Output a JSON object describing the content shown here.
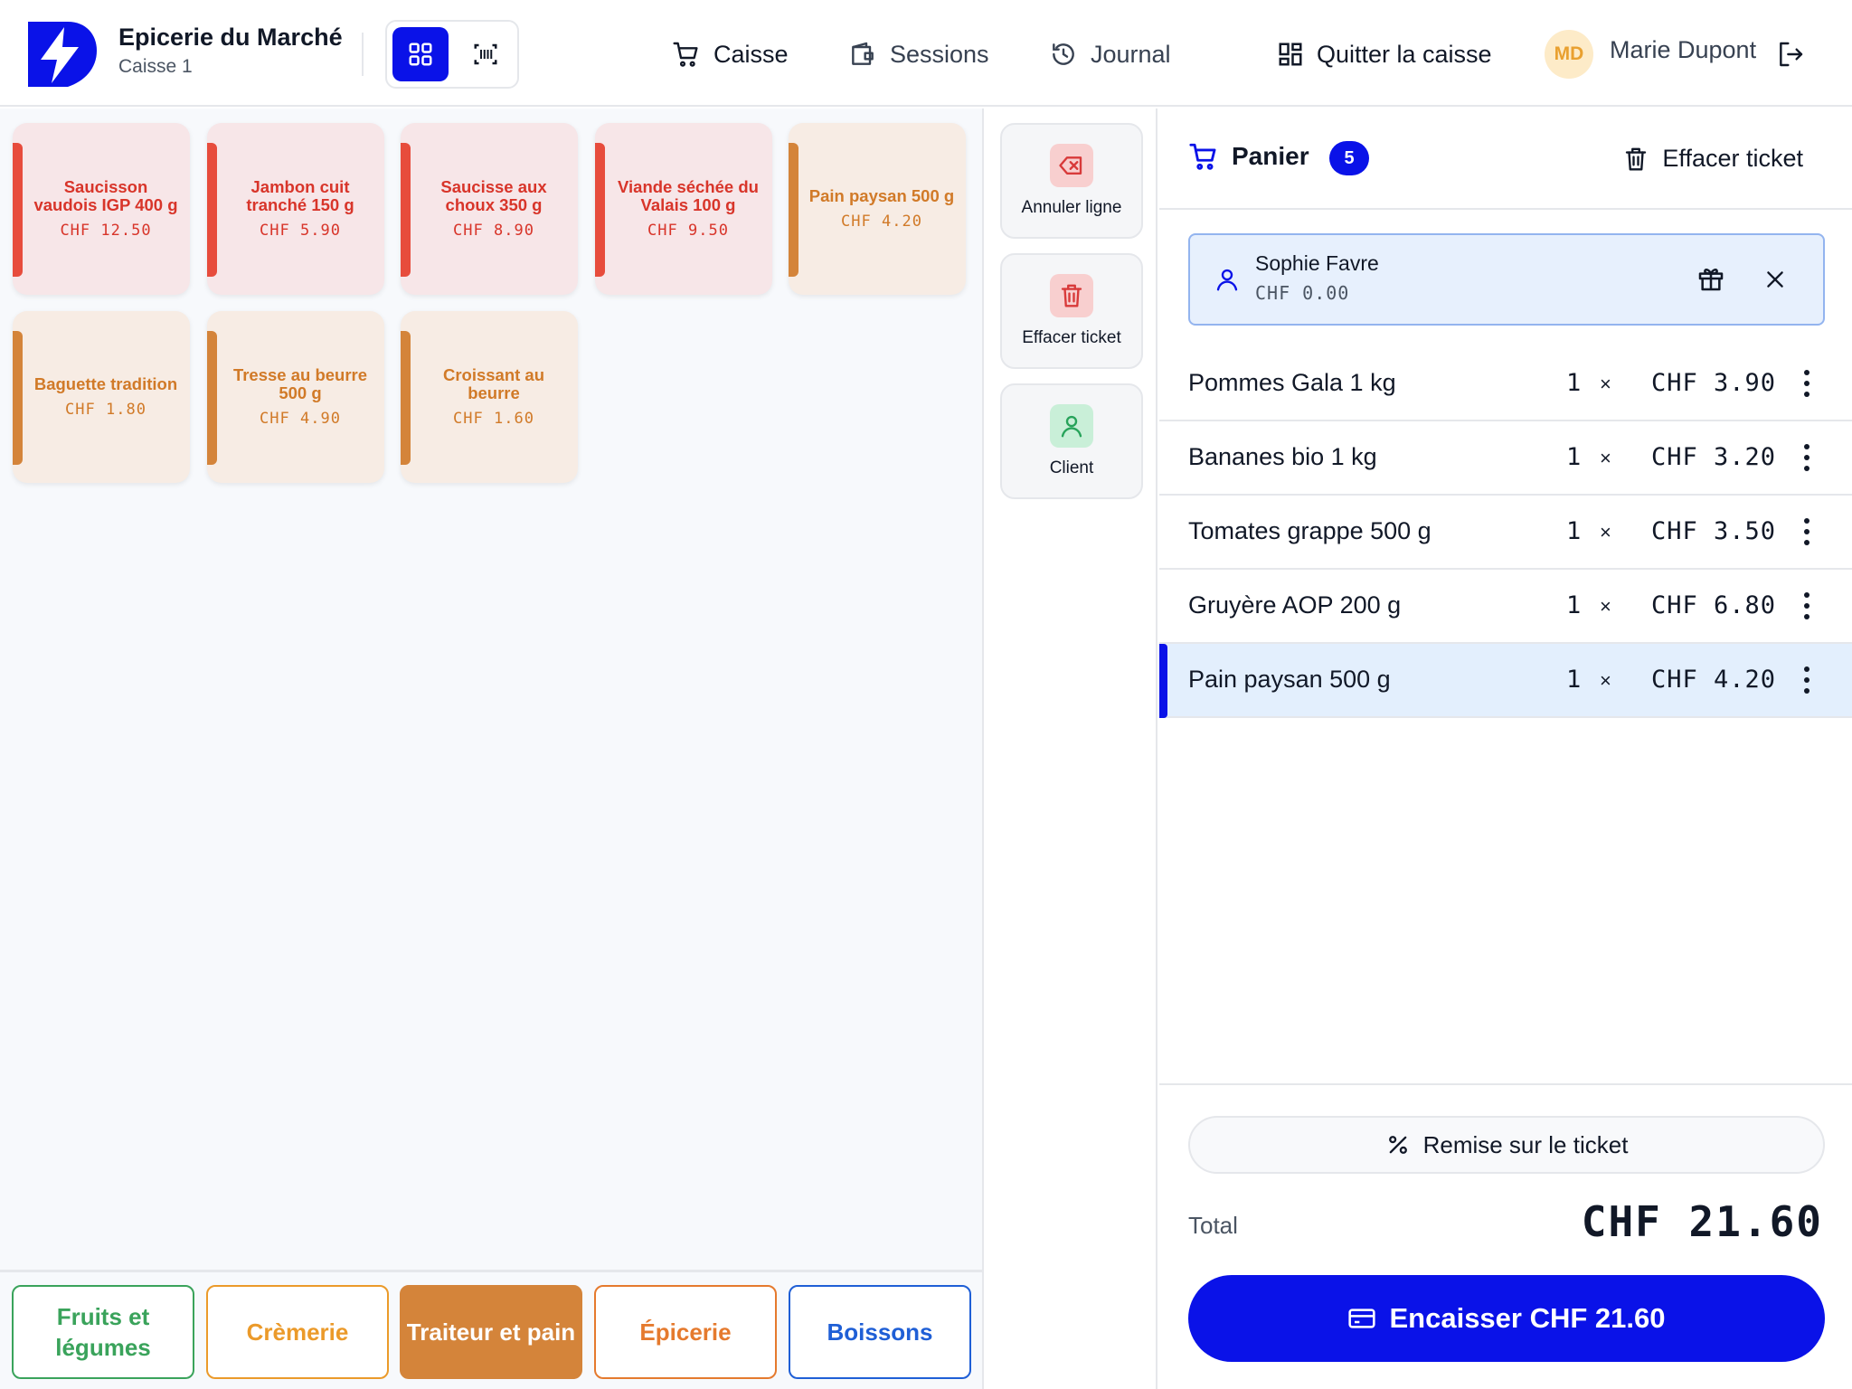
{
  "header": {
    "store_name": "Epicerie du Marché",
    "register": "Caisse 1",
    "nav": [
      {
        "label": "Caisse",
        "icon": "cart-icon",
        "active": true
      },
      {
        "label": "Sessions",
        "icon": "wallet-icon",
        "active": false
      },
      {
        "label": "Journal",
        "icon": "history-icon",
        "active": false
      },
      {
        "label": "Quitter la caisse",
        "icon": "dashboard-icon",
        "active": false
      }
    ],
    "user": {
      "initials": "MD",
      "name": "Marie Dupont"
    }
  },
  "products": [
    {
      "name": "Saucisson vaudois IGP 400 g",
      "price": "CHF 12.50",
      "category": "meat"
    },
    {
      "name": "Jambon cuit tranché 150 g",
      "price": "CHF 5.90",
      "category": "meat"
    },
    {
      "name": "Saucisse aux choux 350 g",
      "price": "CHF 8.90",
      "category": "meat"
    },
    {
      "name": "Viande séchée du Valais 100 g",
      "price": "CHF 9.50",
      "category": "meat"
    },
    {
      "name": "Pain paysan 500 g",
      "price": "CHF 4.20",
      "category": "bread"
    },
    {
      "name": "Baguette tradition",
      "price": "CHF 1.80",
      "category": "bread"
    },
    {
      "name": "Tresse au beurre 500 g",
      "price": "CHF 4.90",
      "category": "bread"
    },
    {
      "name": "Croissant au beurre",
      "price": "CHF 1.60",
      "category": "bread"
    }
  ],
  "categories": [
    {
      "label": "Fruits et légumes",
      "color": "#3aa35b",
      "active": false
    },
    {
      "label": "Crèmerie",
      "color": "#eb9a2a",
      "active": false
    },
    {
      "label": "Traiteur et pain",
      "color": "#d4843a",
      "active": true
    },
    {
      "label": "Épicerie",
      "color": "#e57a2e",
      "active": false
    },
    {
      "label": "Boissons",
      "color": "#1f5fd6",
      "active": false
    }
  ],
  "actions": {
    "undo_line": "Annuler ligne",
    "clear_ticket": "Effacer ticket",
    "client": "Client"
  },
  "cart": {
    "title": "Panier",
    "count": "5",
    "clear_label": "Effacer ticket",
    "customer": {
      "name": "Sophie Favre",
      "balance": "CHF 0.00"
    },
    "lines": [
      {
        "name": "Pommes Gala 1 kg",
        "qty": "1",
        "x": "×",
        "price": "CHF 3.90",
        "selected": false
      },
      {
        "name": "Bananes bio 1 kg",
        "qty": "1",
        "x": "×",
        "price": "CHF 3.20",
        "selected": false
      },
      {
        "name": "Tomates grappe 500 g",
        "qty": "1",
        "x": "×",
        "price": "CHF 3.50",
        "selected": false
      },
      {
        "name": "Gruyère AOP 200 g",
        "qty": "1",
        "x": "×",
        "price": "CHF 6.80",
        "selected": false
      },
      {
        "name": "Pain paysan 500 g",
        "qty": "1",
        "x": "×",
        "price": "CHF 4.20",
        "selected": true
      }
    ],
    "discount_label": "Remise sur le ticket",
    "total_label": "Total",
    "total_value": "CHF 21.60",
    "pay_label": "Encaisser CHF 21.60"
  },
  "colors": {
    "accent": "#0a12e8",
    "meat_accent": "#e74c3c",
    "bread_accent": "#d4843a"
  }
}
